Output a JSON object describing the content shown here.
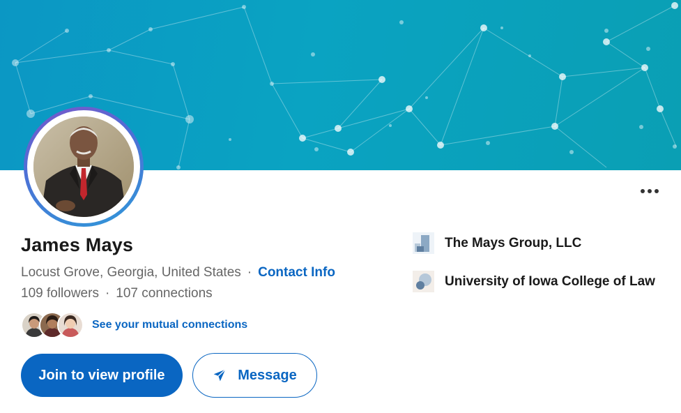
{
  "profile": {
    "name": "James Mays",
    "location": "Locust Grove, Georgia, United States",
    "location_separator": "·",
    "contact_info_label": "Contact Info",
    "followers": "109 followers",
    "stats_separator": "·",
    "connections": "107 connections"
  },
  "mutual": {
    "link_label": "See your mutual connections"
  },
  "actions": {
    "join_label": "Join to view profile",
    "message_label": "Message",
    "more_label": "..."
  },
  "affiliations": [
    {
      "name": "The Mays Group, LLC",
      "icon": "company-logo-icon"
    },
    {
      "name": "University of Iowa College of Law",
      "icon": "school-logo-icon"
    }
  ],
  "colors": {
    "accent": "#0a66c2",
    "banner": "#0aa3c2",
    "muted_text": "#666666"
  }
}
